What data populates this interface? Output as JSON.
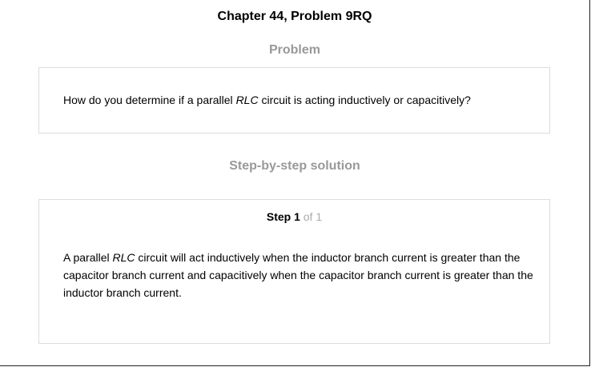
{
  "header": {
    "title": "Chapter 44, Problem 9RQ"
  },
  "problem": {
    "heading": "Problem",
    "text_before": "How do you determine if a parallel ",
    "text_italic": "RLC",
    "text_after": " circuit is acting inductively or capacitively?"
  },
  "solution": {
    "heading": "Step-by-step solution",
    "step_label": "Step 1",
    "step_of": "of 1",
    "text_before": "A parallel ",
    "text_italic": "RLC",
    "text_after": " circuit will act inductively when the inductor branch current is greater than the capacitor branch current and capacitively when the capacitor branch current is greater than the inductor branch current."
  }
}
